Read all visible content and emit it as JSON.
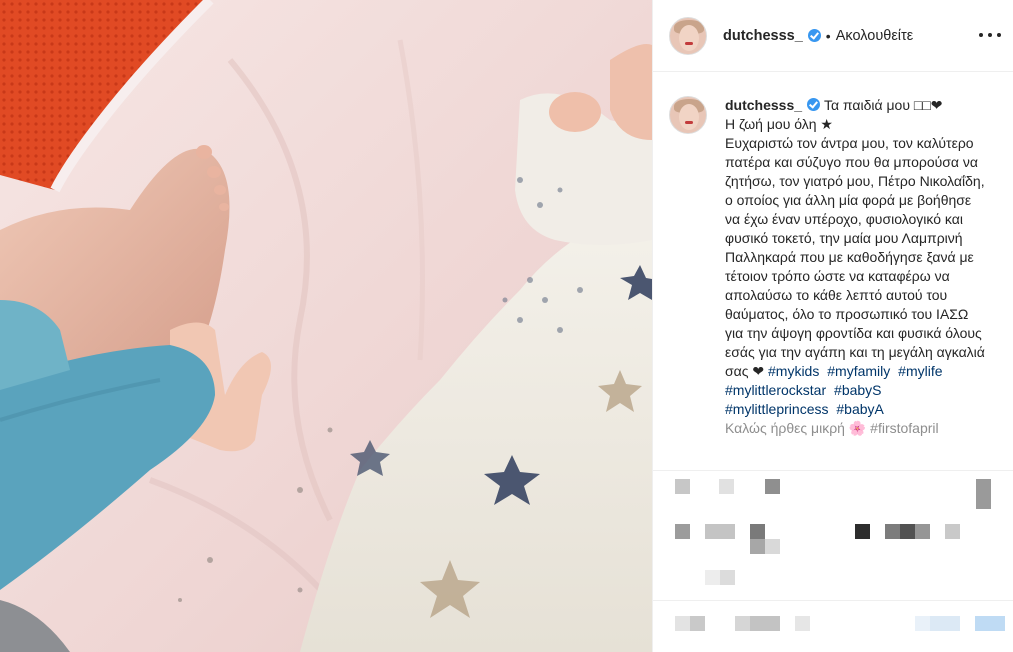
{
  "post": {
    "username": "dutchesss_",
    "follow_label": "Ακολουθείτε",
    "separator": "•"
  },
  "caption": {
    "username": "dutchesss_",
    "line1": "Τα παιδιά μου □□❤",
    "line2": "Η ζωή μου όλη ★",
    "body": "Ευχαριστώ τον άντρα μου, τον καλύτερο πατέρα και σύζυγο που θα μπορούσα να ζητήσω, τον γιατρό μου, Πέτρο Νικολαΐδη, ο οποίος για άλλη μία φορά με βοήθησε να έχω έναν υπέροχο, φυσιολογικό και φυσικό τοκετό, την μαία μου Λαμπρινή Παλληκαρά που με καθοδήγησε ξανά με τέτοιον τρόπο ώστε να καταφέρω να απολαύσω το κάθε λεπτό αυτού του θαύματος, όλο το προσωπικό του ΙΑΣΩ για την άψογη φροντίδα και φυσικά όλους εσάς για την αγάπη και τη μεγάλη αγκαλιά σας ❤",
    "hashtags": [
      "#mykids",
      "#myfamily",
      "#mylife",
      "#mylittlerockstar",
      "#babyS",
      "#mylittleprincess",
      "#babyA"
    ],
    "cut_line": "Καλώς ήρθες μικρή 🌸 #firstofapril"
  },
  "colors": {
    "verified": "#3897f0",
    "hashtag": "#003569",
    "text": "#262626",
    "divider": "#efefef"
  },
  "icons": [
    "verified-icon",
    "more-options-icon"
  ]
}
